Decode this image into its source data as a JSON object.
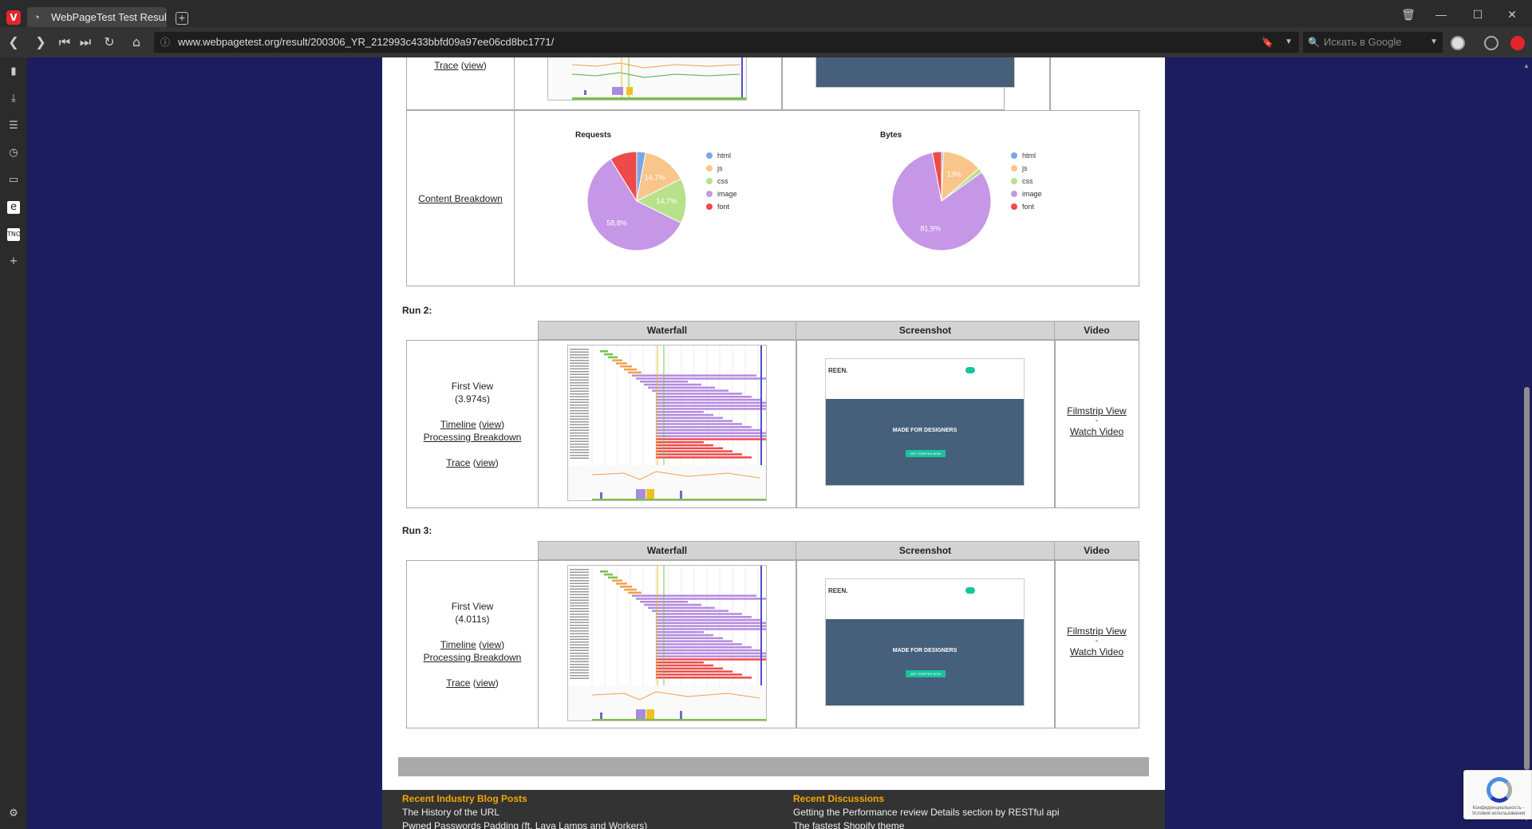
{
  "browser": {
    "tab_title": "WebPageTest Test Result - I",
    "url": "www.webpagetest.org/result/200306_YR_212993c433bbfd09a97ee06cd8bc1771/",
    "search_placeholder": "Искать в Google",
    "accent": "#e3262d"
  },
  "run1_partial": {
    "trace_label": "Trace",
    "trace_view": "view"
  },
  "content_breakdown": {
    "link": "Content Breakdown",
    "legend": [
      {
        "label": "html",
        "color": "#7aa6e8"
      },
      {
        "label": "js",
        "color": "#f9c58a"
      },
      {
        "label": "css",
        "color": "#b7e18a"
      },
      {
        "label": "image",
        "color": "#c597e6"
      },
      {
        "label": "font",
        "color": "#ee4a4a"
      }
    ],
    "requests": {
      "title": "Requests",
      "slices": [
        {
          "label": "html",
          "percent": 2.9
        },
        {
          "label": "js",
          "percent": 14.7
        },
        {
          "label": "css",
          "percent": 14.7
        },
        {
          "label": "image",
          "percent": 58.8
        },
        {
          "label": "font",
          "percent": 8.9
        }
      ],
      "shown_labels": [
        "14,7%",
        "14,7%",
        "58,8%"
      ]
    },
    "bytes": {
      "title": "Bytes",
      "slices": [
        {
          "label": "html",
          "percent": 0.6
        },
        {
          "label": "js",
          "percent": 13.0
        },
        {
          "label": "css",
          "percent": 1.5
        },
        {
          "label": "image",
          "percent": 81.9
        },
        {
          "label": "font",
          "percent": 3.0
        }
      ],
      "shown_labels": [
        "13%",
        "81,9%"
      ]
    }
  },
  "table_headers": {
    "waterfall": "Waterfall",
    "screenshot": "Screenshot",
    "video": "Video"
  },
  "runs": [
    {
      "label": "Run 2:",
      "first_view": "First View",
      "time": "(3.974s)",
      "timeline": "Timeline",
      "view": "view",
      "processing": "Processing Breakdown",
      "trace": "Trace",
      "filmstrip": "Filmstrip View",
      "dash": "-",
      "watch": "Watch Video"
    },
    {
      "label": "Run 3:",
      "first_view": "First View",
      "time": "(4.011s)",
      "timeline": "Timeline",
      "view": "view",
      "processing": "Processing Breakdown",
      "trace": "Trace",
      "filmstrip": "Filmstrip View",
      "dash": "-",
      "watch": "Watch Video"
    }
  ],
  "screenshot_text": {
    "brand": "REEN.",
    "headline": "MADE FOR DESIGNERS",
    "cta": "GET STARTED NOW"
  },
  "footer": {
    "blog_heading": "Recent Industry Blog Posts",
    "blog_items": [
      "The History of the URL",
      "Pwned Passwords Padding (ft. Lava Lamps and Workers)"
    ],
    "discussions_heading": "Recent Discussions",
    "discussion_items": [
      "Getting the Performance review Details section by RESTful api",
      "The fastest Shopify theme"
    ]
  },
  "recaptcha": {
    "text": "Конфиденциальность - Условия использования"
  }
}
